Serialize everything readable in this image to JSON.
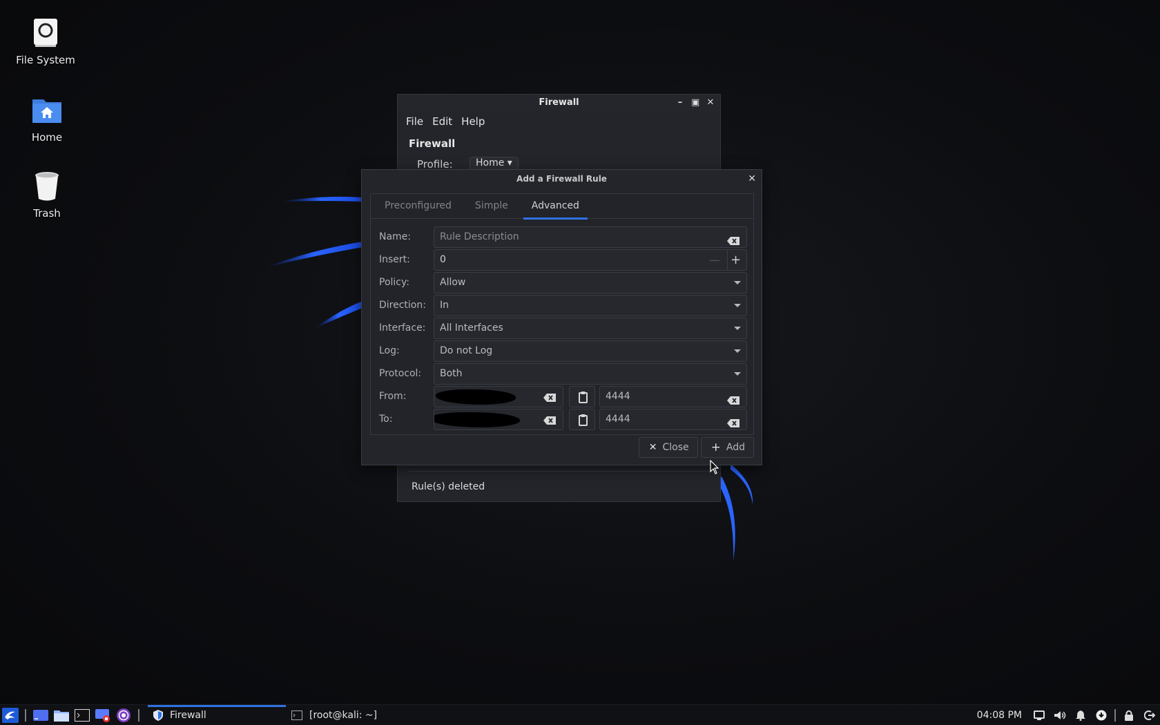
{
  "desktop": {
    "icons": [
      {
        "label": "File System",
        "icon": "drive-icon"
      },
      {
        "label": "Home",
        "icon": "home-folder-icon"
      },
      {
        "label": "Trash",
        "icon": "trash-icon"
      }
    ]
  },
  "firewall_window": {
    "title": "Firewall",
    "menu": [
      "File",
      "Edit",
      "Help"
    ],
    "heading": "Firewall",
    "profile_label": "Profile:",
    "profile_value": "Home",
    "status_text": "Rule(s) deleted"
  },
  "dialog": {
    "title": "Add a Firewall Rule",
    "tabs": [
      "Preconfigured",
      "Simple",
      "Advanced"
    ],
    "active_tab": "Advanced",
    "fields": {
      "name": {
        "label": "Name:",
        "placeholder": "Rule Description"
      },
      "insert": {
        "label": "Insert:",
        "value": "0"
      },
      "policy": {
        "label": "Policy:",
        "value": "Allow"
      },
      "direction": {
        "label": "Direction:",
        "value": "In"
      },
      "interface": {
        "label": "Interface:",
        "value": "All Interfaces"
      },
      "log": {
        "label": "Log:",
        "value": "Do not Log"
      },
      "protocol": {
        "label": "Protocol:",
        "value": "Both"
      },
      "from": {
        "label": "From:",
        "port": "4444"
      },
      "to": {
        "label": "To:",
        "port": "4444"
      }
    },
    "buttons": {
      "close": "Close",
      "add": "Add"
    }
  },
  "taskbar": {
    "tasks": [
      {
        "label": "Firewall",
        "active": true
      },
      {
        "label": "[root@kali: ~]",
        "active": false
      }
    ],
    "clock": "04:08 PM"
  },
  "colors": {
    "accent": "#2f72e2",
    "panel": "#23252b",
    "taskbar": "#101114"
  }
}
